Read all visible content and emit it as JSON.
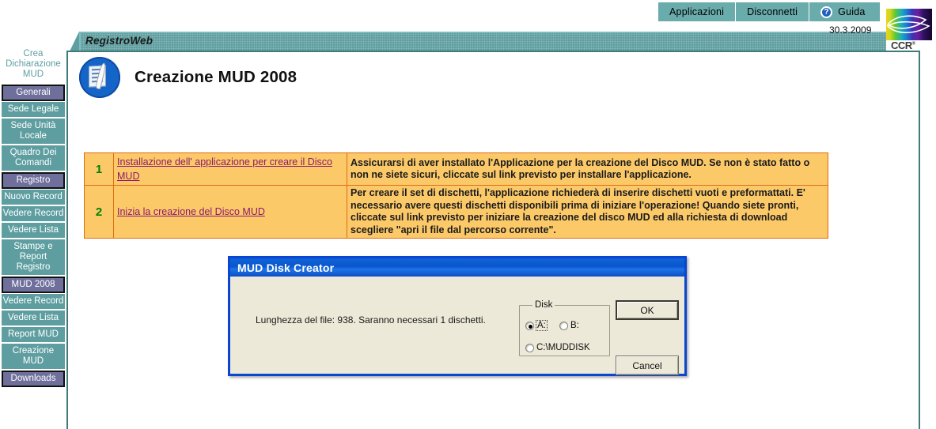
{
  "topnav": {
    "items": [
      {
        "label": "Applicazioni",
        "icon": null
      },
      {
        "label": "Disconnetti",
        "icon": null
      },
      {
        "label": "Guida",
        "icon": "help-question-icon"
      }
    ]
  },
  "logo": {
    "text": "CCR",
    "trademark": "®"
  },
  "banner": {
    "title": "RegistroWeb",
    "date": "30.3.2009"
  },
  "page": {
    "title": "Creazione MUD 2008",
    "icon": "document-quill-icon"
  },
  "sidebar": {
    "heading": "Crea Dichiarazione MUD",
    "items": [
      {
        "label": "Generali",
        "selected": true
      },
      {
        "label": "Sede Legale",
        "selected": false
      },
      {
        "label": "Sede Unità Locale",
        "selected": false
      },
      {
        "label": "Quadro Dei Comandi",
        "selected": false
      },
      {
        "label": "Registro",
        "selected": true
      },
      {
        "label": "Nuovo Record",
        "selected": false
      },
      {
        "label": "Vedere Record",
        "selected": false
      },
      {
        "label": "Vedere Lista",
        "selected": false
      },
      {
        "label": "Stampe e Report Registro",
        "selected": false
      },
      {
        "label": "MUD 2008",
        "selected": true
      },
      {
        "label": "Vedere Record",
        "selected": false
      },
      {
        "label": "Vedere Lista",
        "selected": false
      },
      {
        "label": "Report MUD",
        "selected": false
      },
      {
        "label": "Creazione MUD",
        "selected": false
      },
      {
        "label": "Downloads",
        "selected": true
      }
    ]
  },
  "instructions": {
    "rows": [
      {
        "number": "1",
        "link": "Installazione dell' applicazione per creare il Disco MUD",
        "description": "Assicurarsi di aver installato l'Applicazione per la creazione del Disco MUD. Se non è stato fatto o non ne siete sicuri, cliccate sul link previsto per installare l'applicazione."
      },
      {
        "number": "2",
        "link": "Inizia la creazione del Disco MUD",
        "description": "Per creare il set di dischetti, l'applicazione richiederà di inserire dischetti vuoti e preformattati. E' necessario avere questi dischetti disponibili prima di iniziare l'operazione! Quando siete pronti, cliccate sul link previsto per iniziare la creazione del disco MUD ed alla richiesta di download scegliere \"apri il file dal percorso corrente\"."
      }
    ]
  },
  "dialog": {
    "title": "MUD Disk Creator",
    "message": "Lunghezza del file: 938. Saranno necessari 1 dischetti.",
    "group_label": "Disk",
    "options": [
      {
        "label": "A:",
        "selected": true,
        "focused": true
      },
      {
        "label": "B:",
        "selected": false,
        "focused": false
      },
      {
        "label": "C:\\MUDDISK",
        "selected": false,
        "focused": false
      }
    ],
    "ok_label": "OK",
    "cancel_label": "Cancel"
  },
  "colors": {
    "teal": "#5f9ea0",
    "selected_purple": "#6f6f9c",
    "instruction_bg": "#fcc969",
    "instruction_border": "#e06b12",
    "link": "#8b1a6b",
    "number": "#008000",
    "dialog_title": "#0a55cd",
    "dialog_bg": "#ece9d8"
  }
}
